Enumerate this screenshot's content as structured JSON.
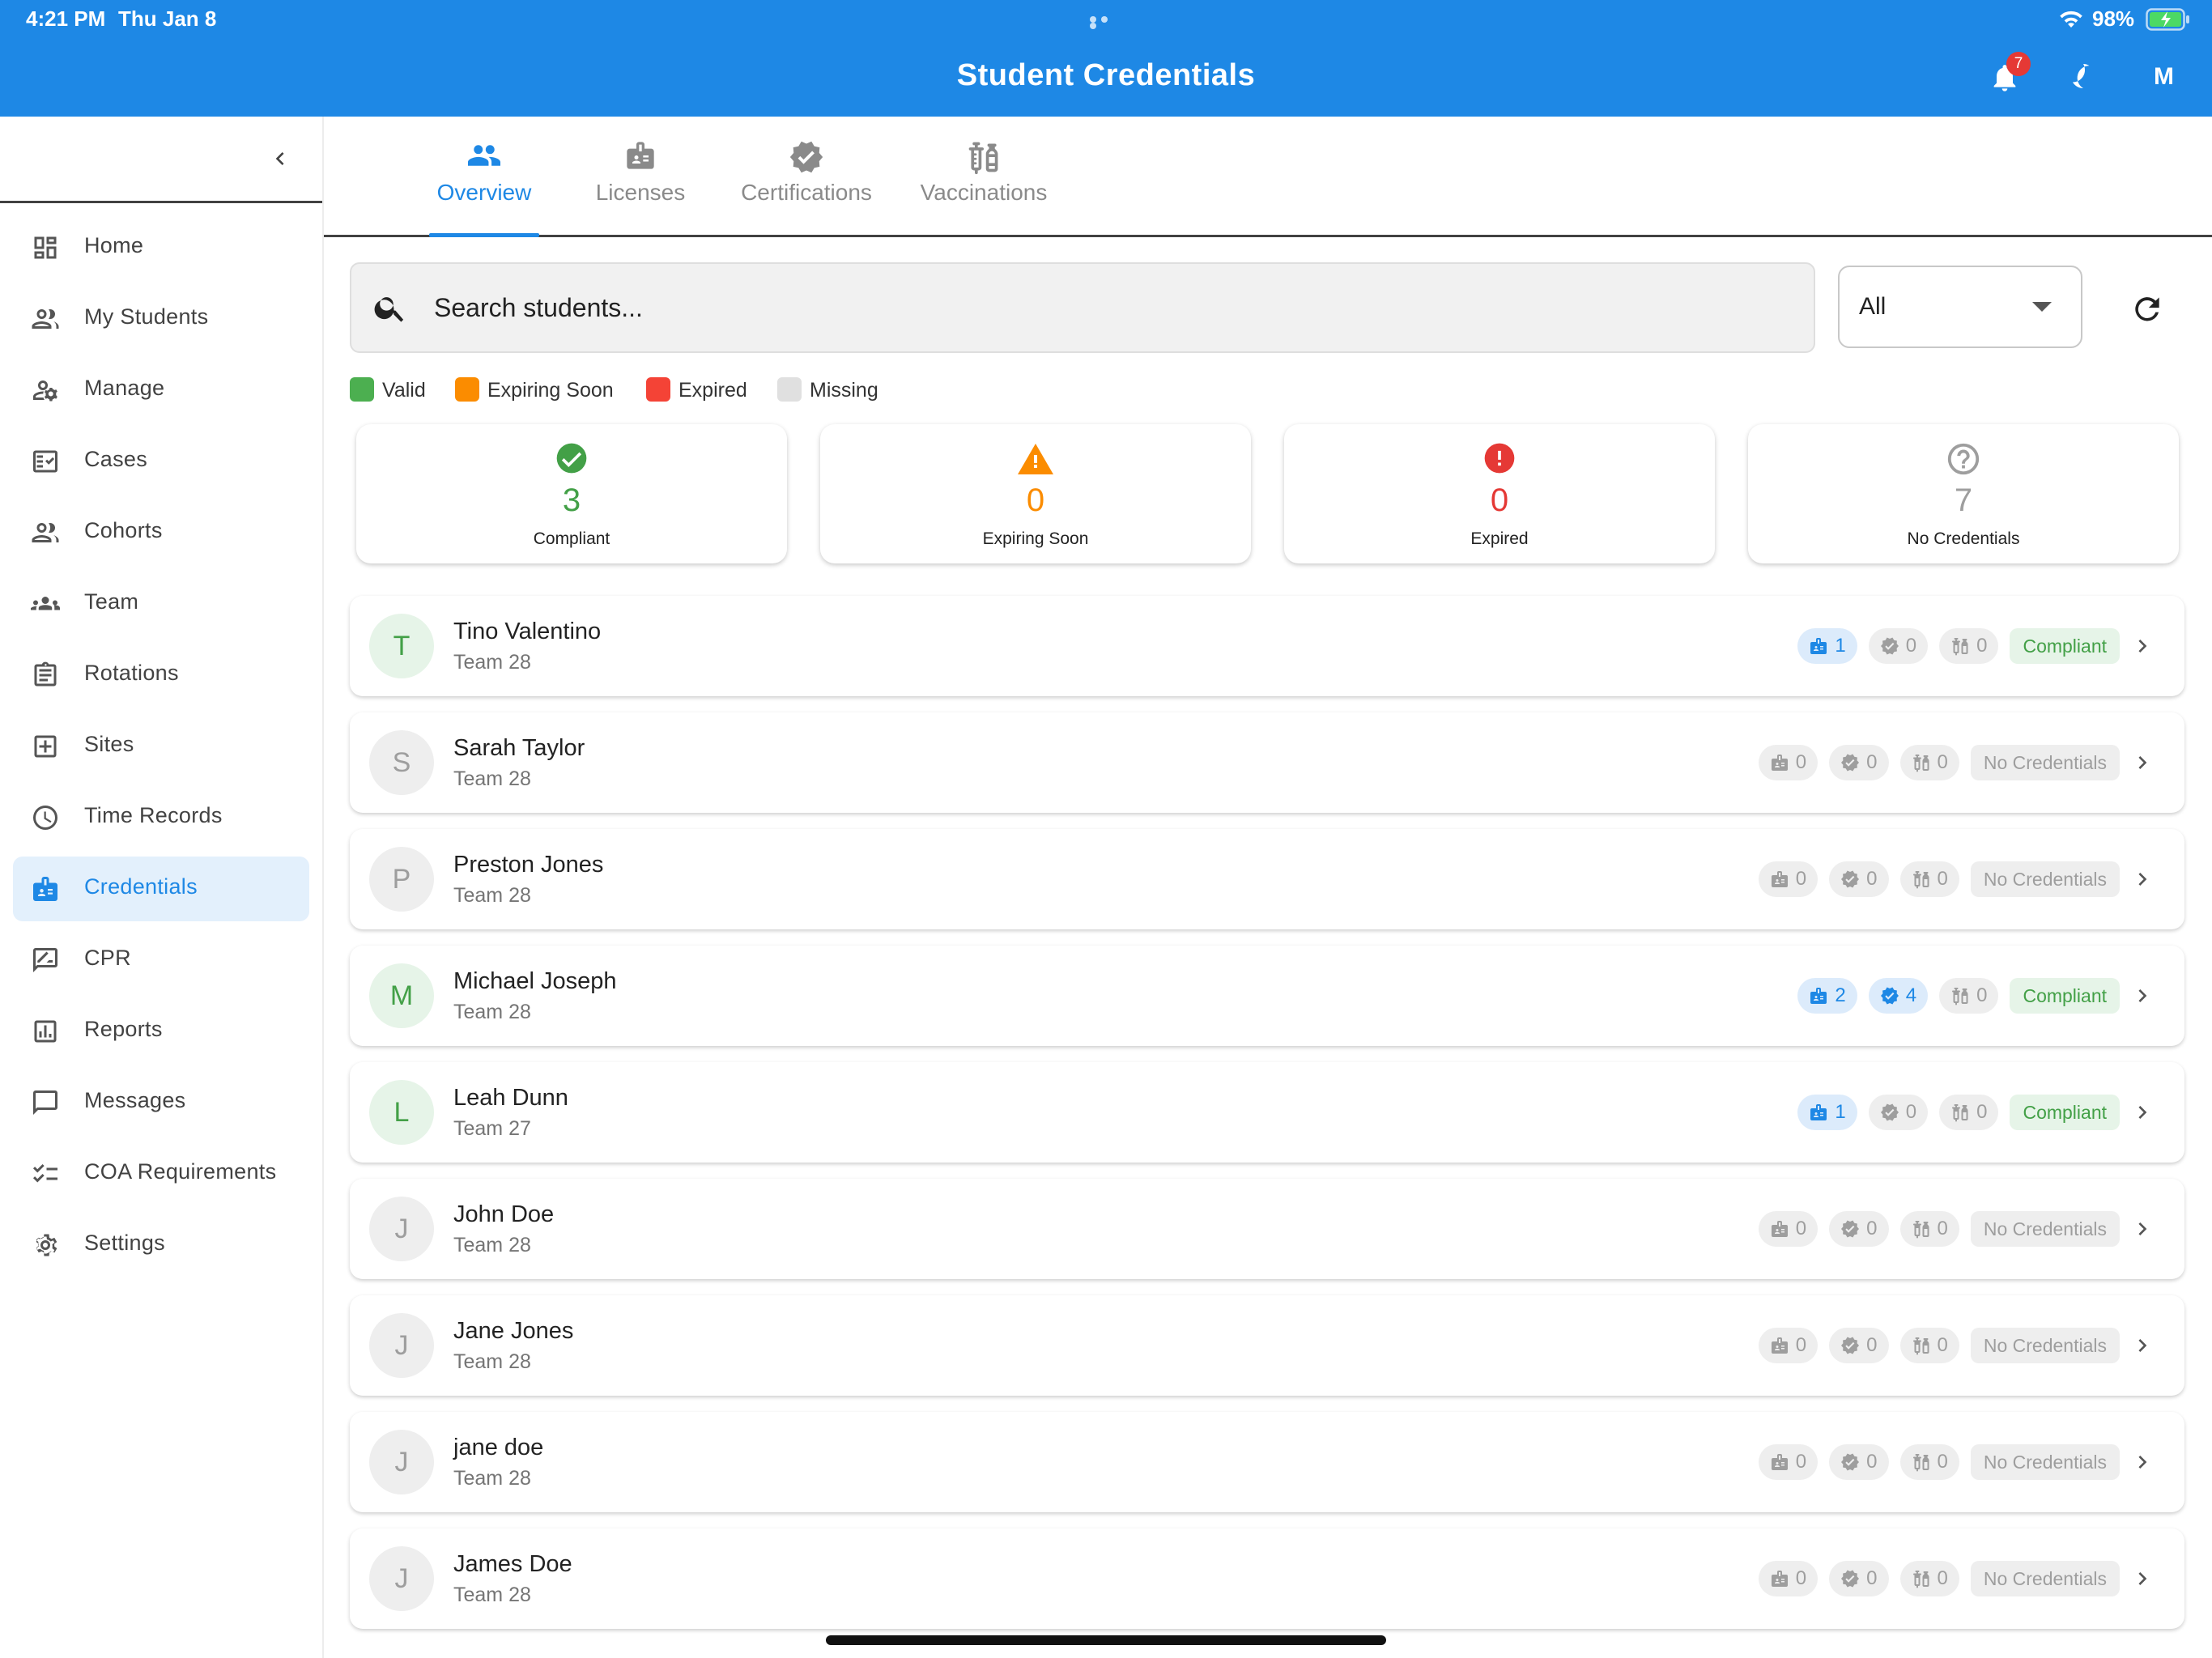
{
  "status_bar": {
    "time": "4:21 PM",
    "date": "Thu Jan 8",
    "battery": "98%"
  },
  "header": {
    "title": "Student Credentials",
    "notification_count": "7",
    "avatar_initial": "M"
  },
  "sidebar": {
    "items": [
      {
        "label": "Home",
        "icon": "dashboard-icon"
      },
      {
        "label": "My Students",
        "icon": "people-icon"
      },
      {
        "label": "Manage",
        "icon": "manage-accounts-icon"
      },
      {
        "label": "Cases",
        "icon": "fact-check-icon"
      },
      {
        "label": "Cohorts",
        "icon": "people-icon"
      },
      {
        "label": "Team",
        "icon": "groups-icon"
      },
      {
        "label": "Rotations",
        "icon": "clipboard-icon"
      },
      {
        "label": "Sites",
        "icon": "add-box-icon"
      },
      {
        "label": "Time Records",
        "icon": "clock-icon"
      },
      {
        "label": "Credentials",
        "icon": "badge-icon",
        "active": true
      },
      {
        "label": "CPR",
        "icon": "draw-icon"
      },
      {
        "label": "Reports",
        "icon": "chart-icon"
      },
      {
        "label": "Messages",
        "icon": "message-icon"
      },
      {
        "label": "COA Requirements",
        "icon": "checklist-icon"
      },
      {
        "label": "Settings",
        "icon": "gear-icon"
      }
    ]
  },
  "tabs": [
    {
      "label": "Overview",
      "icon": "people-icon",
      "active": true
    },
    {
      "label": "Licenses",
      "icon": "badge-icon"
    },
    {
      "label": "Certifications",
      "icon": "verified-icon"
    },
    {
      "label": "Vaccinations",
      "icon": "vaccine-icon"
    }
  ],
  "search": {
    "placeholder": "Search students..."
  },
  "filter": {
    "value": "All"
  },
  "legend": [
    {
      "label": "Valid",
      "color": "#4caf50"
    },
    {
      "label": "Expiring Soon",
      "color": "#fb8c00"
    },
    {
      "label": "Expired",
      "color": "#f44336"
    },
    {
      "label": "Missing",
      "color": "#e0e0e0"
    }
  ],
  "stats": [
    {
      "value": "3",
      "label": "Compliant",
      "color": "#43a047",
      "icon": "check-circle-icon"
    },
    {
      "value": "0",
      "label": "Expiring Soon",
      "color": "#fb8c00",
      "icon": "warning-icon"
    },
    {
      "value": "0",
      "label": "Expired",
      "color": "#e53935",
      "icon": "error-icon"
    },
    {
      "value": "7",
      "label": "No Credentials",
      "color": "#9e9e9e",
      "icon": "help-icon"
    }
  ],
  "students": [
    {
      "initial": "T",
      "name": "Tino Valentino",
      "team": "Team 28",
      "licenses": "1",
      "certifications": "0",
      "vaccinations": "0",
      "status": "Compliant"
    },
    {
      "initial": "S",
      "name": "Sarah Taylor",
      "team": "Team 28",
      "licenses": "0",
      "certifications": "0",
      "vaccinations": "0",
      "status": "No Credentials"
    },
    {
      "initial": "P",
      "name": "Preston Jones",
      "team": "Team 28",
      "licenses": "0",
      "certifications": "0",
      "vaccinations": "0",
      "status": "No Credentials"
    },
    {
      "initial": "M",
      "name": "Michael Joseph",
      "team": "Team 28",
      "licenses": "2",
      "certifications": "4",
      "vaccinations": "0",
      "status": "Compliant"
    },
    {
      "initial": "L",
      "name": "Leah Dunn",
      "team": "Team 27",
      "licenses": "1",
      "certifications": "0",
      "vaccinations": "0",
      "status": "Compliant"
    },
    {
      "initial": "J",
      "name": "John Doe",
      "team": "Team 28",
      "licenses": "0",
      "certifications": "0",
      "vaccinations": "0",
      "status": "No Credentials"
    },
    {
      "initial": "J",
      "name": "Jane Jones",
      "team": "Team 28",
      "licenses": "0",
      "certifications": "0",
      "vaccinations": "0",
      "status": "No Credentials"
    },
    {
      "initial": "J",
      "name": "jane doe",
      "team": "Team 28",
      "licenses": "0",
      "certifications": "0",
      "vaccinations": "0",
      "status": "No Credentials"
    },
    {
      "initial": "J",
      "name": "James Doe",
      "team": "Team 28",
      "licenses": "0",
      "certifications": "0",
      "vaccinations": "0",
      "status": "No Credentials"
    }
  ]
}
